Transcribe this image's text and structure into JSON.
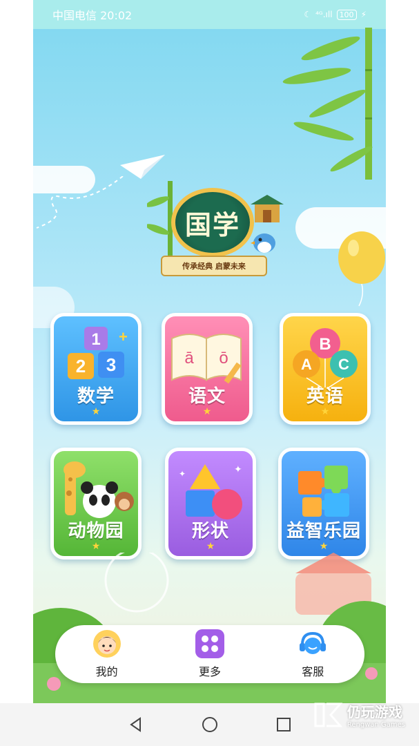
{
  "status_bar": {
    "carrier_time": "中国电信 20:02",
    "signal": "⁴ᴳ.ıll",
    "battery": "100"
  },
  "logo": {
    "title": "国学",
    "ribbon": "传承经典  启蒙未来"
  },
  "tiles": [
    {
      "label": "数学",
      "art_text": [
        "1",
        "2",
        "3"
      ]
    },
    {
      "label": "语文",
      "art_text": [
        "ā",
        "ō"
      ]
    },
    {
      "label": "英语",
      "art_text": [
        "A",
        "B",
        "C"
      ]
    },
    {
      "label": "动物园"
    },
    {
      "label": "形状"
    },
    {
      "label": "益智乐园"
    }
  ],
  "nav": {
    "items": [
      {
        "label": "我的"
      },
      {
        "label": "更多"
      },
      {
        "label": "客服"
      }
    ]
  },
  "watermark": {
    "name": "仍玩游戏",
    "sub": "Rengwan Games"
  },
  "colors": {
    "math": "#3aa7ef",
    "chinese": "#f36a98",
    "english": "#f9bf21",
    "zoo": "#6cc84a",
    "shapes": "#a56ae6",
    "puzzle": "#3c95ee"
  }
}
